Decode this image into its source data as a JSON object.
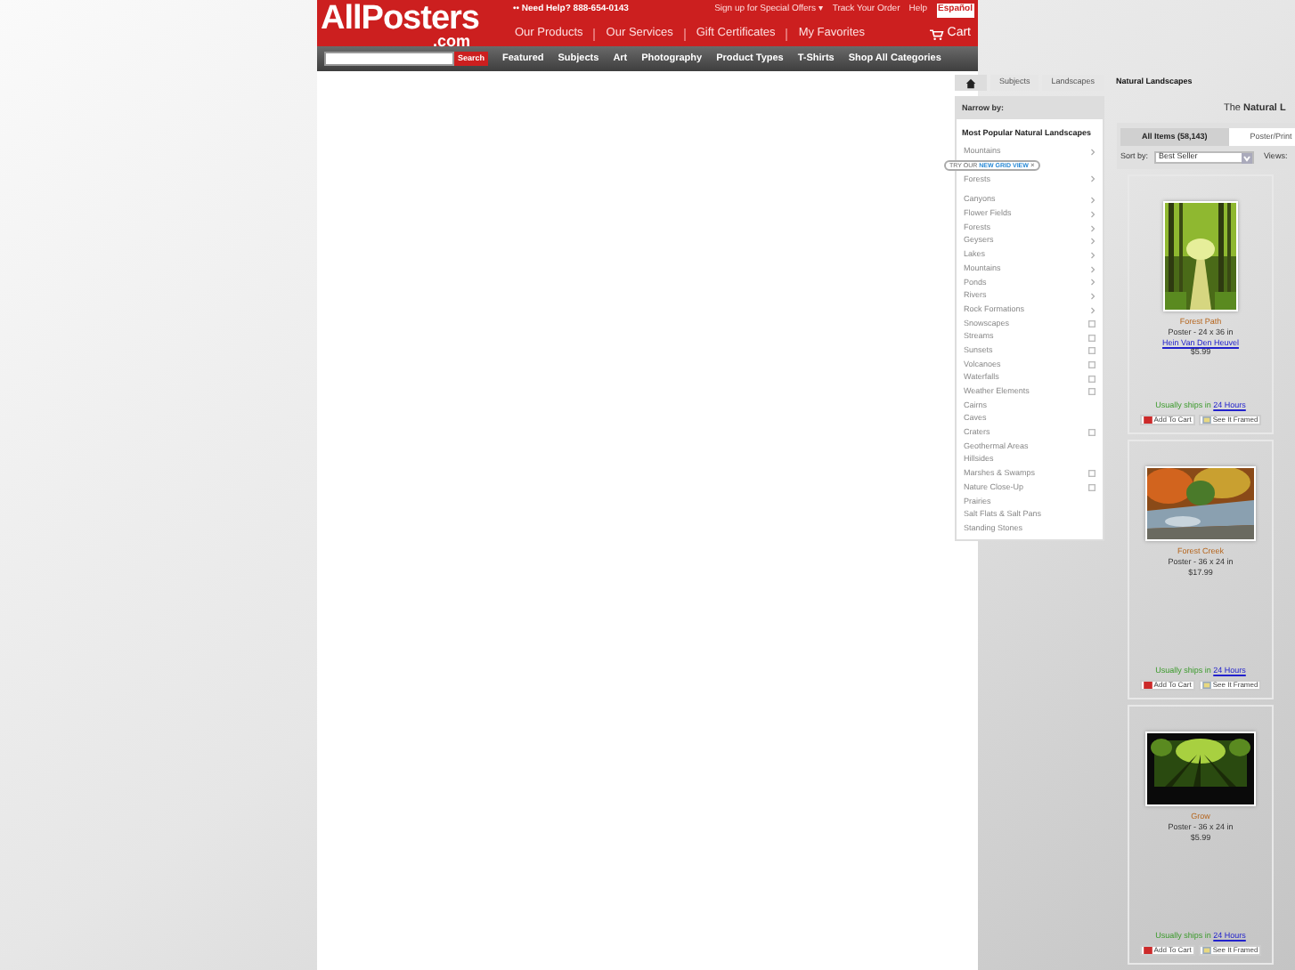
{
  "header": {
    "logo": "AllPosters",
    "logo_suffix": ".com",
    "help": "•• Need Help? 888-654-0143",
    "top_links": [
      "Sign up for Special Offers ▾",
      "Track Your Order",
      "Help"
    ],
    "language": "Español",
    "main_links": [
      "Our Products",
      "Our Services",
      "Gift Certificates",
      "My Favorites"
    ],
    "cart": "Cart"
  },
  "nav": {
    "search_button": "Search",
    "items": [
      "Featured",
      "Subjects",
      "Art",
      "Photography",
      "Product Types",
      "T-Shirts",
      "Shop All Categories"
    ]
  },
  "breadcrumb": [
    "Subjects",
    "Landscapes",
    "Natural Landscapes"
  ],
  "sidebar": {
    "heading": "Narrow by:",
    "section": "Most Popular Natural Landscapes",
    "popular": [
      {
        "label": "Mountains",
        "kind": "chevron"
      },
      {
        "label": "Forests",
        "kind": "chevron"
      }
    ],
    "items": [
      {
        "label": "Canyons",
        "kind": "chevron"
      },
      {
        "label": "Flower Fields",
        "kind": "chevron"
      },
      {
        "label": "Forests",
        "kind": "chevron"
      },
      {
        "label": "Geysers",
        "kind": "chevron"
      },
      {
        "label": "Lakes",
        "kind": "chevron"
      },
      {
        "label": "Mountains",
        "kind": "chevron"
      },
      {
        "label": "Ponds",
        "kind": "chevron"
      },
      {
        "label": "Rivers",
        "kind": "chevron"
      },
      {
        "label": "Rock Formations",
        "kind": "chevron"
      },
      {
        "label": "Snowscapes",
        "kind": "box"
      },
      {
        "label": "Streams",
        "kind": "box"
      },
      {
        "label": "Sunsets",
        "kind": "box"
      },
      {
        "label": "Volcanoes",
        "kind": "box"
      },
      {
        "label": "Waterfalls",
        "kind": "box"
      },
      {
        "label": "Weather Elements",
        "kind": "box"
      },
      {
        "label": "Cairns",
        "kind": "none"
      },
      {
        "label": "Caves",
        "kind": "none"
      },
      {
        "label": "Craters",
        "kind": "box"
      },
      {
        "label": "Geothermal Areas",
        "kind": "none"
      },
      {
        "label": "Hillsides",
        "kind": "none"
      },
      {
        "label": "Marshes & Swamps",
        "kind": "box"
      },
      {
        "label": "Nature Close-Up",
        "kind": "box"
      },
      {
        "label": "Prairies",
        "kind": "none"
      },
      {
        "label": "Salt Flats & Salt Pans",
        "kind": "none"
      },
      {
        "label": "Standing Stones",
        "kind": "none"
      }
    ]
  },
  "tooltip": {
    "prefix": "TRY OUR",
    "link": "NEW GRID VIEW",
    "close": "×"
  },
  "results": {
    "title": "The **Natural L**",
    "tabs": [
      {
        "label": "All Items (58,143)",
        "selected": true
      },
      {
        "label": "Poster/Print",
        "selected": false
      }
    ],
    "sort_label": "Sort by:",
    "sort_value": "Best Seller",
    "views_label": "Views:"
  },
  "products": [
    {
      "title": "Forest Path",
      "format": "Poster - 24 x 36 in",
      "artist": "Hein Van Den Heuvel",
      "price": "$5.99",
      "shipping": "Usually ships in",
      "shipping_link": "24 Hours",
      "cart_button": "Add To Cart",
      "frame_button": "See It Framed"
    },
    {
      "title": "Forest Creek",
      "format": "Poster - 36 x 24 in",
      "price": "$17.99",
      "shipping": "Usually ships in",
      "shipping_link": "24 Hours",
      "cart_button": "Add To Cart",
      "frame_button": "See It Framed"
    },
    {
      "title": "Grow",
      "format": "Poster - 36 x 24 in",
      "price": "$5.99",
      "shipping": "Usually ships in",
      "shipping_link": "24 Hours",
      "cart_button": "Add To Cart",
      "frame_button": "See It Framed"
    }
  ]
}
